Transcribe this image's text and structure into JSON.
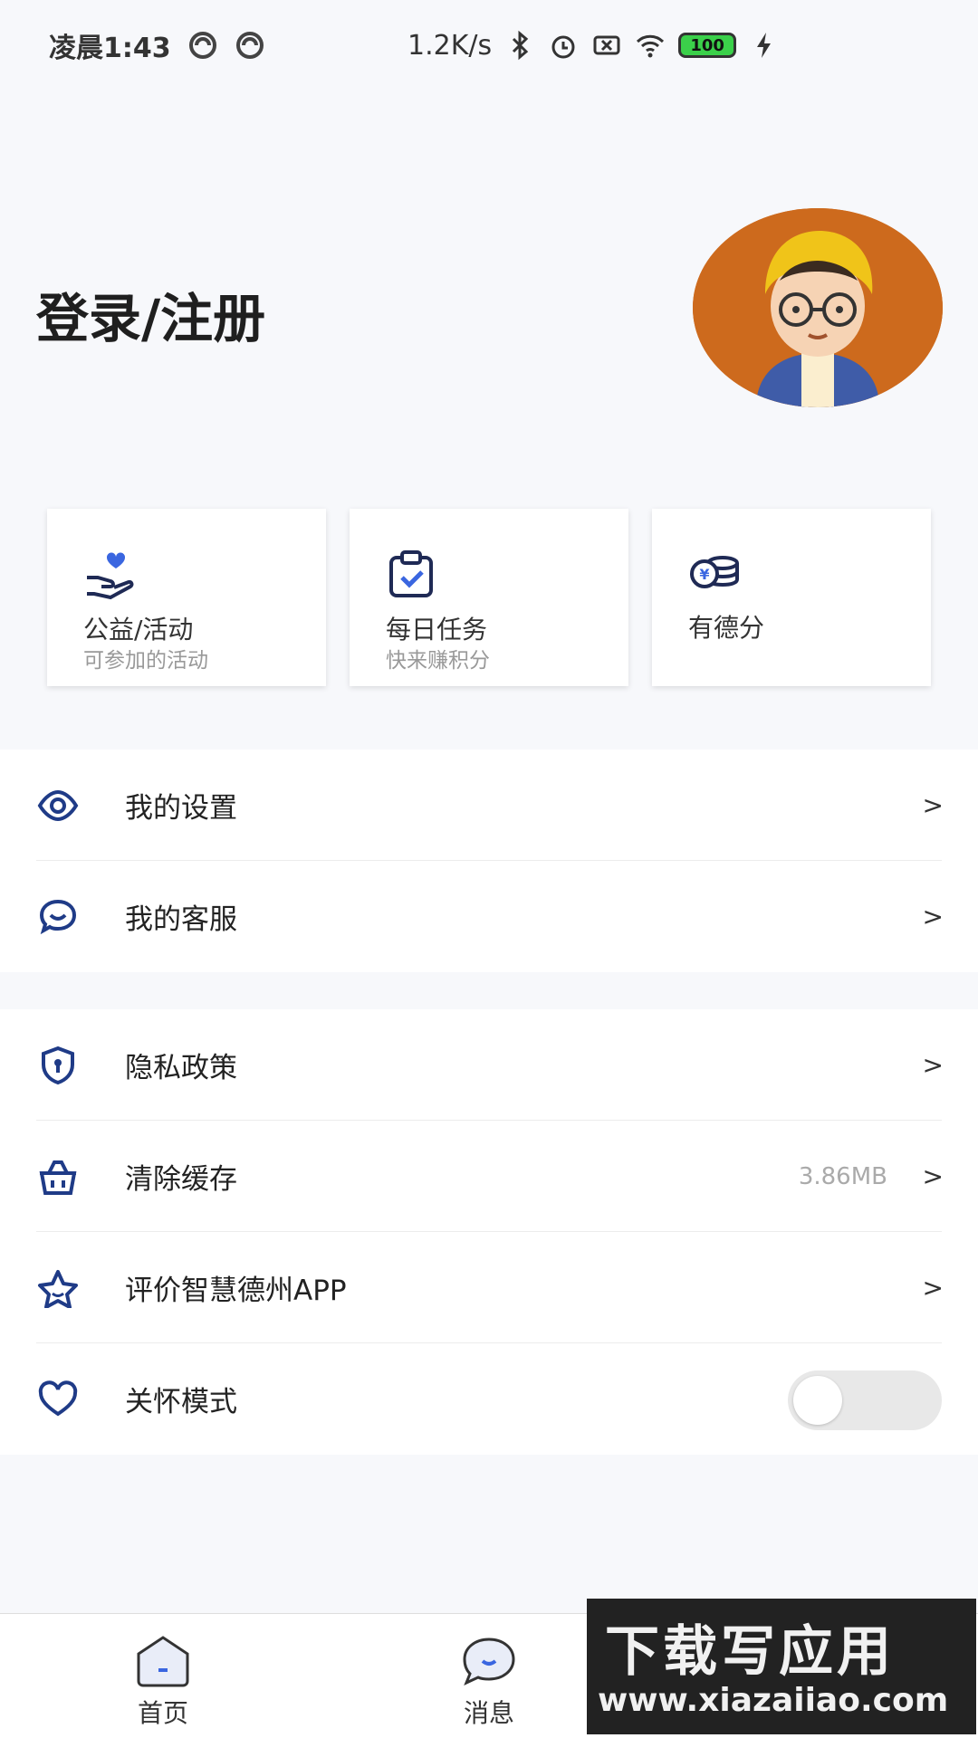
{
  "status_bar": {
    "time": "凌晨1:43",
    "net_speed": "1.2K/s",
    "battery": "100"
  },
  "header": {
    "login_text": "登录/注册"
  },
  "cards": [
    {
      "title": "公益/活动",
      "subtitle": "可参加的活动",
      "icon": "heart-hand-icon"
    },
    {
      "title": "每日任务",
      "subtitle": "快来赚积分",
      "icon": "clipboard-check-icon"
    },
    {
      "title": "有德分",
      "subtitle": "",
      "icon": "coins-icon"
    }
  ],
  "group1": [
    {
      "label": "我的设置",
      "icon": "eye-icon"
    },
    {
      "label": "我的客服",
      "icon": "chat-smile-icon"
    }
  ],
  "group2": [
    {
      "label": "隐私政策",
      "icon": "shield-icon",
      "value": ""
    },
    {
      "label": "清除缓存",
      "icon": "basket-icon",
      "value": "3.86MB"
    },
    {
      "label": "评价智慧德州APP",
      "icon": "star-icon",
      "value": ""
    }
  ],
  "care_mode": {
    "label": "关怀模式",
    "icon": "heart-icon",
    "enabled": false
  },
  "chevron": ">",
  "tabs": [
    {
      "label": "首页",
      "icon": "home-icon"
    },
    {
      "label": "消息",
      "icon": "message-icon"
    }
  ],
  "watermark": {
    "line1": "下载写应用",
    "line2": "www.xiazaiiao.com"
  },
  "colors": {
    "icon_blue": "#1f3b87",
    "avatar_bg": "#cd6a1d"
  }
}
